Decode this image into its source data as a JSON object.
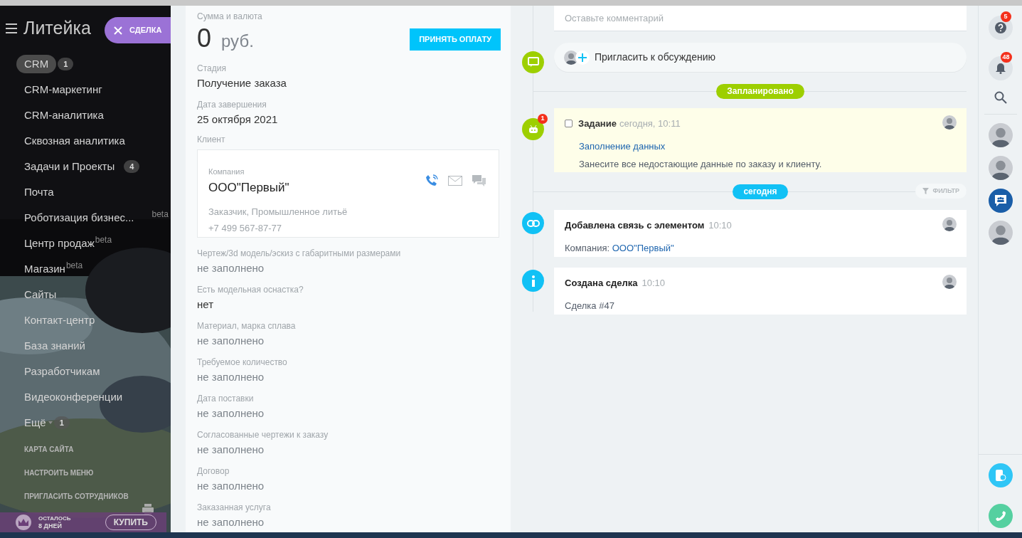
{
  "sidebar": {
    "title": "Литейка",
    "deal_button": "СДЕЛКА",
    "items": [
      {
        "label": "CRM",
        "badge": "1",
        "selected": true
      },
      {
        "label": "CRM-маркетинг",
        "selected": false
      },
      {
        "label": "CRM-аналитика",
        "selected": false
      },
      {
        "label": "Сквозная аналитика",
        "selected": false
      },
      {
        "label": "Задачи и Проекты",
        "badge": "4",
        "selected": false
      },
      {
        "label": "Почта",
        "selected": false
      },
      {
        "label": "Роботизация бизнес...",
        "beta": "beta",
        "selected": false
      },
      {
        "label": "Центр продаж",
        "beta": "beta",
        "selected": false
      },
      {
        "label": "Магазин",
        "beta": "beta",
        "selected": false
      },
      {
        "label": "Сайты",
        "selected": false
      },
      {
        "label": "Контакт-центр",
        "selected": false
      },
      {
        "label": "База знаний",
        "selected": false
      },
      {
        "label": "Разработчикам",
        "selected": false
      },
      {
        "label": "Видеоконференции",
        "selected": false
      },
      {
        "label": "Ещё",
        "badge": "1",
        "dropdown": true,
        "selected": false
      }
    ],
    "links": [
      "КАРТА САЙТА",
      "НАСТРОИТЬ МЕНЮ",
      "ПРИГЛАСИТЬ СОТРУДНИКОВ"
    ],
    "trial": {
      "line1": "ОСТАЛОСЬ",
      "line2": "8 ДНЕЙ",
      "button": "КУПИТЬ"
    }
  },
  "form": {
    "amount_label": "Сумма и валюта",
    "amount": "0",
    "currency": "руб.",
    "pay_button": "ПРИНЯТЬ ОПЛАТУ",
    "fields_top": [
      {
        "label": "Стадия",
        "value": "Получение заказа"
      },
      {
        "label": "Дата завершения",
        "value": "25 октября 2021"
      }
    ],
    "client_label": "Клиент",
    "client": {
      "type_label": "Компания",
      "name": "ООО\"Первый\"",
      "details": "Заказчик, Промышленное литьё",
      "phone": "+7 499 567-87-77"
    },
    "fields": [
      {
        "label": "Чертеж/3d модель/эскиз с габаритными размерами",
        "value": "не заполнено",
        "filled": false
      },
      {
        "label": "Есть модельная оснастка?",
        "value": "нет",
        "filled": true
      },
      {
        "label": "Материал, марка сплава",
        "value": "не заполнено",
        "filled": false
      },
      {
        "label": "Требуемое количество",
        "value": "не заполнено",
        "filled": false
      },
      {
        "label": "Дата поставки",
        "value": "не заполнено",
        "filled": false
      },
      {
        "label": "Согласованные чертежи к заказу",
        "value": "не заполнено",
        "filled": false
      },
      {
        "label": "Договор",
        "value": "не заполнено",
        "filled": false
      },
      {
        "label": "Заказанная услуга",
        "value": "не заполнено",
        "filled": false
      }
    ]
  },
  "timeline": {
    "comment_placeholder": "Оставьте комментарий",
    "invite": "Пригласить к обсуждению",
    "planned_label": "Запланировано",
    "task": {
      "title": "Задание",
      "time": "сегодня, 10:11",
      "checked": false,
      "badge": "1",
      "link": "Заполнение данных",
      "text": "Занесите все недостающие данные по заказу и клиенту."
    },
    "today_label": "сегодня",
    "filter_button": "ФИЛЬТР",
    "events": [
      {
        "kind": "link",
        "title": "Добавлена связь с элементом",
        "time": "10:10",
        "text": "Компания: ",
        "link": "ООО\"Первый\""
      },
      {
        "kind": "info",
        "title": "Создана сделка",
        "time": "10:10",
        "text": "Сделка #47"
      }
    ]
  },
  "right_bar": {
    "help_badge": "5",
    "notifications_badge": "48"
  }
}
